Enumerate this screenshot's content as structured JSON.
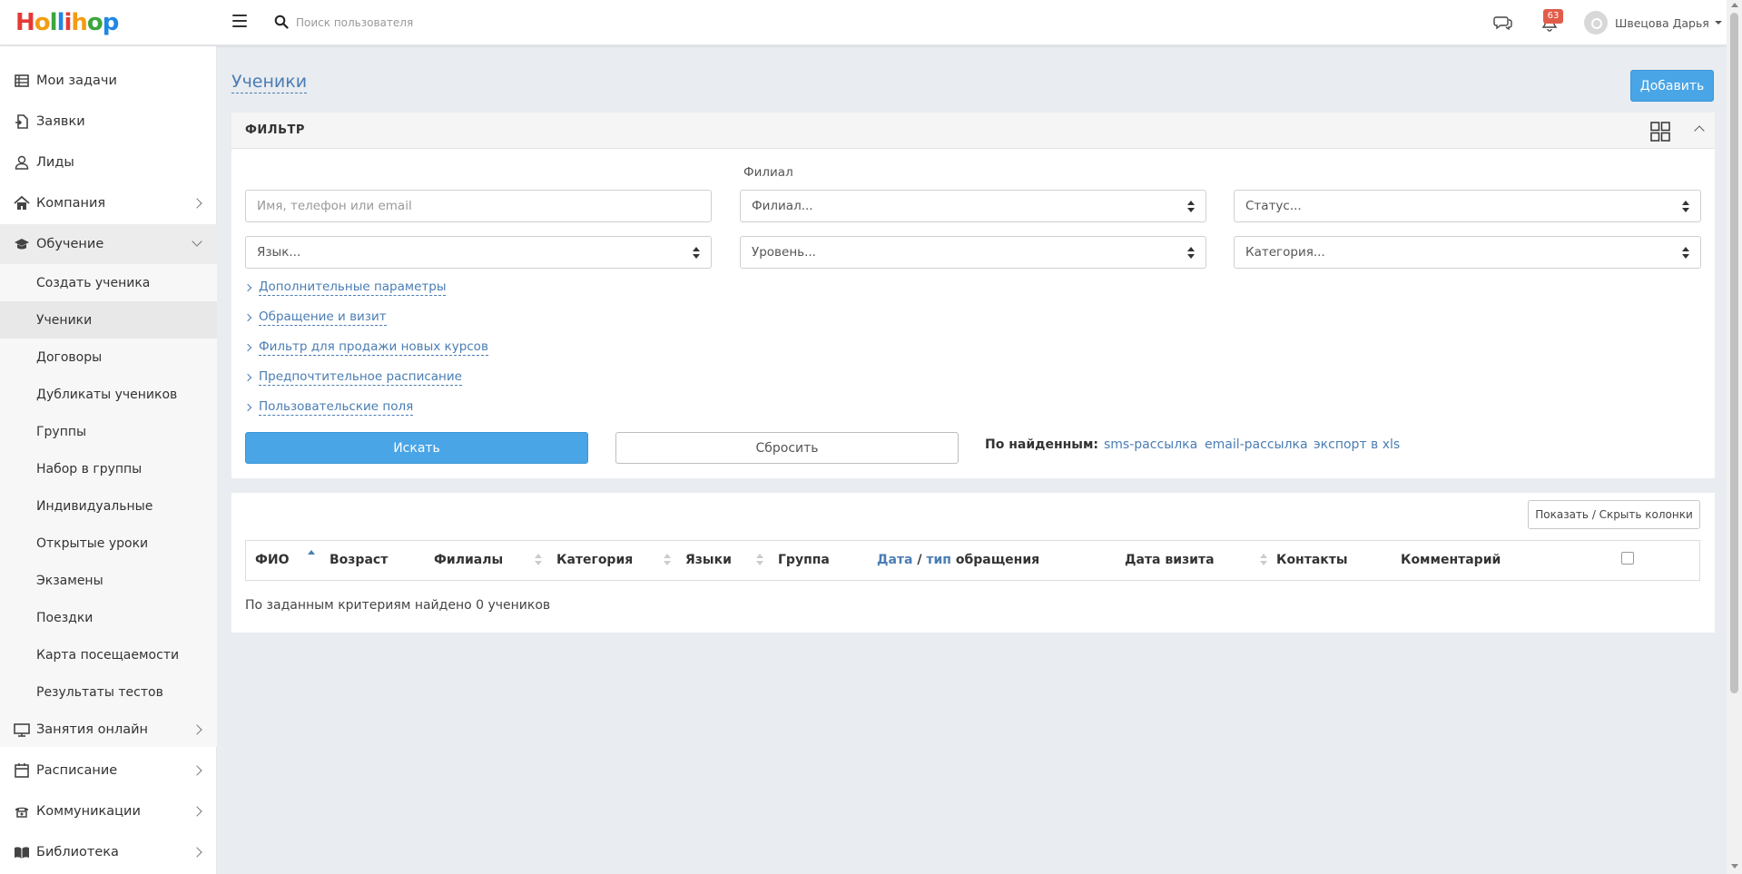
{
  "brand": {
    "logo_text": "Hollihop",
    "logo_letters": [
      {
        "ch": "H",
        "color": "#e53935"
      },
      {
        "ch": "o",
        "color": "#f39c12"
      },
      {
        "ch": "l",
        "color": "#3da63d"
      },
      {
        "ch": "l",
        "color": "#1e88e5"
      },
      {
        "ch": "i",
        "color": "#e53935"
      },
      {
        "ch": "h",
        "color": "#f39c12"
      },
      {
        "ch": "o",
        "color": "#3da63d"
      },
      {
        "ch": "p",
        "color": "#1e88e5"
      }
    ]
  },
  "topbar": {
    "search_placeholder": "Поиск пользователя",
    "notifications_count": "63",
    "user_name": "Швецова Дарья"
  },
  "sidebar": {
    "items": [
      {
        "label": "Мои задачи",
        "icon": "list-icon"
      },
      {
        "label": "Заявки",
        "icon": "request-icon"
      },
      {
        "label": "Лиды",
        "icon": "user-icon"
      },
      {
        "label": "Компания",
        "icon": "home-icon"
      },
      {
        "label": "Обучение",
        "icon": "graduation-cap-icon"
      }
    ],
    "sub_items": [
      "Создать ученика",
      "Ученики",
      "Договоры",
      "Дубликаты учеников",
      "Группы",
      "Набор в группы",
      "Индивидуальные",
      "Открытые уроки",
      "Экзамены",
      "Поездки",
      "Карта посещаемости",
      "Результаты тестов"
    ],
    "bottom_items": [
      {
        "label": "Занятия онлайн",
        "icon": "monitor-icon"
      },
      {
        "label": "Расписание",
        "icon": "calendar-icon"
      },
      {
        "label": "Коммуникации",
        "icon": "phone-icon"
      },
      {
        "label": "Библиотека",
        "icon": "book-icon"
      }
    ]
  },
  "page": {
    "title": "Ученики",
    "add_button": "Добавить"
  },
  "filter": {
    "title": "ФИЛЬТР",
    "branch_label": "Филиал",
    "name_placeholder": "Имя, телефон или email",
    "branch_select": "Филиал...",
    "status_select": "Статус...",
    "language_select": "Язык...",
    "level_select": "Уровень...",
    "category_select": "Категория...",
    "expanders": [
      "Дополнительные параметры",
      "Обращение и визит",
      "Фильтр для продажи новых курсов",
      "Предпочтительное расписание",
      "Пользовательские поля"
    ],
    "search_button": "Искать",
    "reset_button": "Сбросить",
    "found_label": "По найденным:",
    "found_links": [
      "sms-рассылка",
      "email-рассылка",
      "экспорт в xls"
    ]
  },
  "results": {
    "columns_button": "Показать / Скрыть колонки",
    "headers": {
      "fio": "ФИО",
      "age": "Возраст",
      "branches": "Филиалы",
      "category": "Категория",
      "languages": "Языки",
      "group": "Группа",
      "date_link": "Дата",
      "slash": " / ",
      "type_link": "тип",
      "appeal": " обращения",
      "visit_date": "Дата визита",
      "contacts": "Контакты",
      "comment": "Комментарий"
    },
    "empty_message": "По заданным критериям найдено 0 учеников"
  },
  "colors": {
    "accent": "#49a5e6",
    "link": "#4a7db3",
    "badge": "#e25c4b"
  }
}
